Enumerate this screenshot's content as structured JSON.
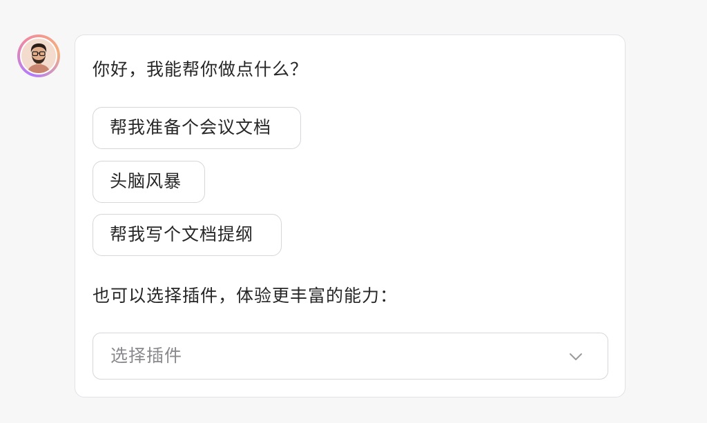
{
  "assistant": {
    "avatar_icon": "user-avatar-icon"
  },
  "message": {
    "greeting": "你好，我能帮你做点什么？",
    "suggestions": [
      {
        "label": "帮我准备个会议文档"
      },
      {
        "label": "头脑风暴"
      },
      {
        "label": "帮我写个文档提纲"
      }
    ],
    "plugin_hint": "也可以选择插件，体验更丰富的能力："
  },
  "plugin_select": {
    "placeholder": "选择插件",
    "icon": "chevron-down-icon"
  },
  "colors": {
    "background": "#f7f7f8",
    "card_border": "#e2e2e6",
    "avatar_ring": [
      "#b07bff",
      "#f08aa0",
      "#f5b07b"
    ]
  }
}
